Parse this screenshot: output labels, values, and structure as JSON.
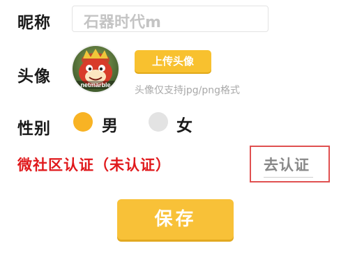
{
  "form": {
    "nickname_label": "昵称",
    "nickname_value": "石器时代m",
    "avatar_label": "头像",
    "avatar_badge_text": "netmarble",
    "upload_button": "上传头像",
    "avatar_hint": "头像仅支持jpg/png格式",
    "gender_label": "性别",
    "gender_male": "男",
    "gender_female": "女",
    "gender_selected": "男",
    "certification_text": "微社区认证（未认证）",
    "certify_button": "去认证",
    "save_button": "保存"
  },
  "colors": {
    "accent_yellow": "#f8c138",
    "alert_red": "#e0181b"
  }
}
